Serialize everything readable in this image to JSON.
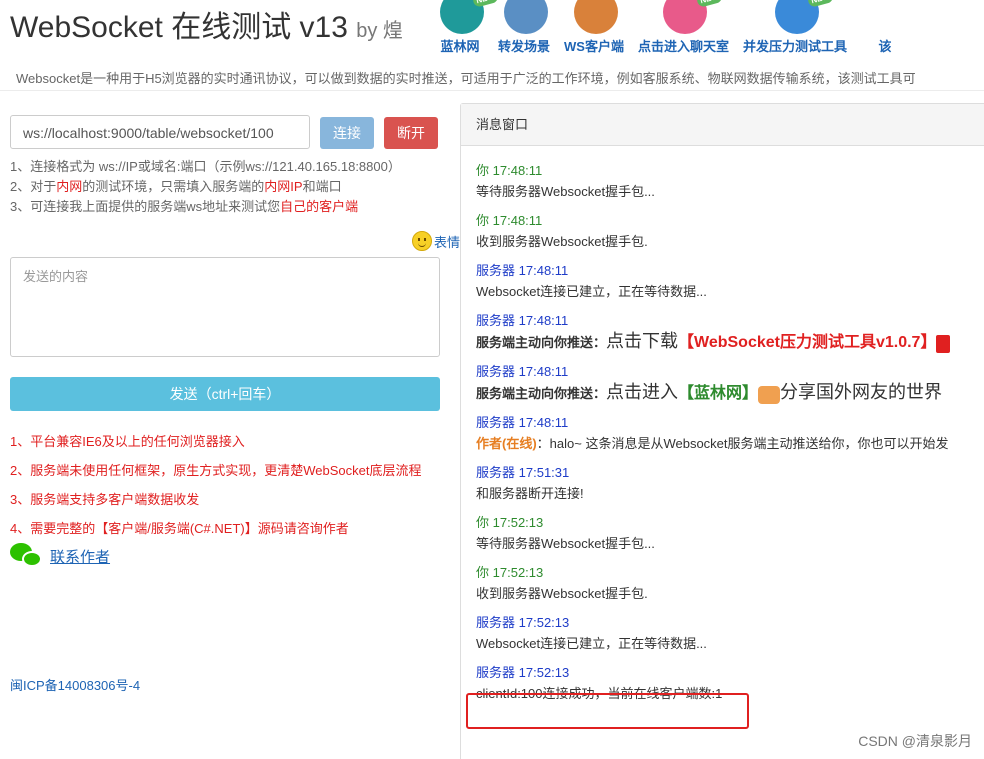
{
  "header": {
    "title": "WebSocket 在线测试 v13",
    "by": "by 煌",
    "nav": [
      {
        "label": "蓝林网",
        "icon": "globe-icon",
        "color": "#1f9a9a",
        "new": "NEW"
      },
      {
        "label": "转发场景",
        "icon": "signal-tower-icon",
        "color": "#5a8fc4",
        "new": ""
      },
      {
        "label": "WS客户端",
        "icon": "speaker-icon",
        "color": "#d9813a",
        "new": ""
      },
      {
        "label": "点击进入聊天室",
        "icon": "chat-user-icon",
        "color": "#e85a8a",
        "new": "NEW"
      },
      {
        "label": "并发压力测试工具",
        "icon": "pencil-tool-icon",
        "color": "#3a8ad9",
        "new": "NEW"
      },
      {
        "label": "该",
        "icon": "",
        "color": "#ffffff",
        "new": ""
      }
    ],
    "intro": "Websocket是一种用于H5浏览器的实时通讯协议，可以做到数据的实时推送，可适用于广泛的工作环境，例如客服系统、物联网数据传输系统，该测试工具可"
  },
  "connect": {
    "url": "ws://localhost:9000/table/websocket/100",
    "connect_label": "连接",
    "disconnect_label": "断开"
  },
  "tips": {
    "t1": "1、连接格式为 ws://IP或域名:端口（示例ws://121.40.165.18:8800）",
    "t2_a": "2、对于",
    "t2_b": "内网",
    "t2_c": "的测试环境，只需填入服务端的",
    "t2_d": "内网IP",
    "t2_e": "和端口",
    "t3_a": "3、可连接我上面提供的服务端ws地址来测试您",
    "t3_b": "自己的客户端"
  },
  "emoji_label": "表情",
  "send": {
    "placeholder": "发送的内容",
    "button_label": "发送（ctrl+回车）"
  },
  "notes": [
    "1、平台兼容IE6及以上的任何浏览器接入",
    "2、服务端未使用任何框架，原生方式实现，更清楚WebSocket底层流程",
    "3、服务端支持多客户端数据收发",
    "4、需要完整的【客户端/服务端(C#.NET)】源码请咨询作者"
  ],
  "contact_label": "联系作者",
  "icp": "闽ICP备14008306号-4",
  "panel": {
    "title": "消息窗口",
    "messages": [
      {
        "who": "你",
        "time": "17:48:11",
        "text": "等待服务器Websocket握手包..."
      },
      {
        "who": "你",
        "time": "17:48:11",
        "text": "收到服务器Websocket握手包."
      },
      {
        "who": "服务器",
        "time": "17:48:11",
        "text": "Websocket连接已建立，正在等待数据..."
      },
      {
        "who": "服务器",
        "time": "17:48:11",
        "prefix": "服务端主动向你推送：",
        "text": "点击下载",
        "link": "【WebSocket压力测试工具v1.0.7】"
      },
      {
        "who": "服务器",
        "time": "17:48:11",
        "prefix": "服务端主动向你推送：",
        "text": "点击进入",
        "link": "【蓝林网】",
        "tail": "分享国外网友的世界"
      },
      {
        "who": "服务器",
        "time": "17:48:11",
        "author": "作者(在线)",
        "text": "：halo~ 这条消息是从Websocket服务端主动推送给你，你也可以开始发"
      },
      {
        "who": "服务器",
        "time": "17:51:31",
        "text": "和服务器断开连接!"
      },
      {
        "who": "你",
        "time": "17:52:13",
        "text": "等待服务器Websocket握手包..."
      },
      {
        "who": "你",
        "time": "17:52:13",
        "text": "收到服务器Websocket握手包."
      },
      {
        "who": "服务器",
        "time": "17:52:13",
        "text": "Websocket连接已建立，正在等待数据..."
      },
      {
        "who": "服务器",
        "time": "17:52:13",
        "text": "clientId:100连接成功，当前在线客户端数:1"
      }
    ]
  },
  "watermark": "CSDN @清泉影月"
}
